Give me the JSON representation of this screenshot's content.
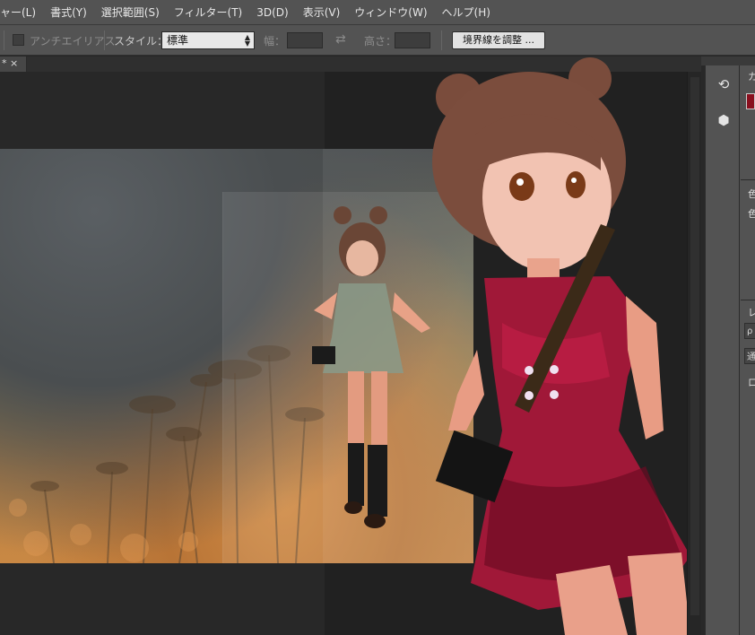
{
  "menubar": {
    "items": [
      "ャー(L)",
      "書式(Y)",
      "選択範囲(S)",
      "フィルター(T)",
      "3D(D)",
      "表示(V)",
      "ウィンドウ(W)",
      "ヘルプ(H)"
    ]
  },
  "options": {
    "antialias_label": "アンチエイリアス",
    "style_label": "スタイル：",
    "style_value": "標準",
    "width_label": "幅：",
    "height_label": "高さ：",
    "refine_button": "境界線を調整 ..."
  },
  "document": {
    "tab_label": "* ×"
  },
  "right_panel": {
    "label_top": "カ",
    "label_color1": "色",
    "label_color2": "色",
    "label_layers": "レ",
    "label_box1": "ρ",
    "label_box2": "通",
    "label_box3": "ロ"
  },
  "colors": {
    "foreground_swatch": "#8a0f1e",
    "chrome": "#535353",
    "canvas_bg": "#282828"
  }
}
